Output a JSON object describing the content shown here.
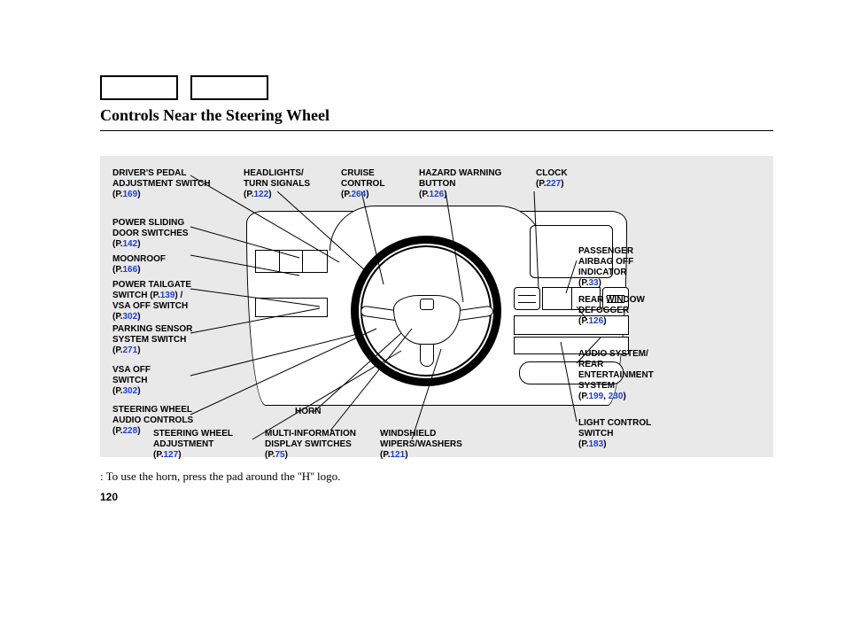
{
  "title": "Controls Near the Steering Wheel",
  "page_number": "120",
  "footnote": ":   To use the horn, press the pad around the ''H'' logo.",
  "callouts": {
    "drivers_pedal": {
      "label": "DRIVER'S PEDAL\nADJUSTMENT SWITCH",
      "page": "169"
    },
    "headlights": {
      "label": "HEADLIGHTS/\nTURN SIGNALS",
      "page": "122"
    },
    "cruise": {
      "label": "CRUISE\nCONTROL",
      "page": "264"
    },
    "hazard": {
      "label": "HAZARD WARNING\nBUTTON",
      "page": "126"
    },
    "clock": {
      "label": "CLOCK",
      "page": "227"
    },
    "power_sliding": {
      "label": "POWER SLIDING\nDOOR SWITCHES",
      "page": "142"
    },
    "moonroof": {
      "label": "MOONROOF",
      "page": "166"
    },
    "power_tailgate": {
      "label": "POWER TAILGATE\nSWITCH",
      "page": "139",
      "extra_label": " /\nVSA OFF SWITCH",
      "extra_page": "302"
    },
    "parking_sensor": {
      "label": "PARKING SENSOR\nSYSTEM SWITCH",
      "page": "271"
    },
    "vsa_off": {
      "label": "VSA OFF\nSWITCH",
      "page": "302"
    },
    "wheel_audio": {
      "label": "STEERING WHEEL\nAUDIO CONTROLS",
      "page": "228"
    },
    "wheel_adjust": {
      "label": "STEERING WHEEL\nADJUSTMENT",
      "page": "127"
    },
    "horn": {
      "label": "HORN",
      "page": ""
    },
    "multi_info": {
      "label": "MULTI-INFORMATION\nDISPLAY SWITCHES",
      "page": "75"
    },
    "windshield": {
      "label": "WINDSHIELD\nWIPERS/WASHERS",
      "page": "121"
    },
    "passenger_airbag": {
      "label": "PASSENGER\nAIRBAG OFF\nINDICATOR",
      "page": "33"
    },
    "rear_defogger": {
      "label": "REAR WINDOW\nDEFOGGER",
      "page": "126"
    },
    "audio_system": {
      "label": "AUDIO SYSTEM/\nREAR\nENTERTAINMENT\nSYSTEM",
      "pages": [
        "199",
        "230"
      ]
    },
    "light_control": {
      "label": "LIGHT CONTROL\nSWITCH",
      "page": "183"
    }
  }
}
